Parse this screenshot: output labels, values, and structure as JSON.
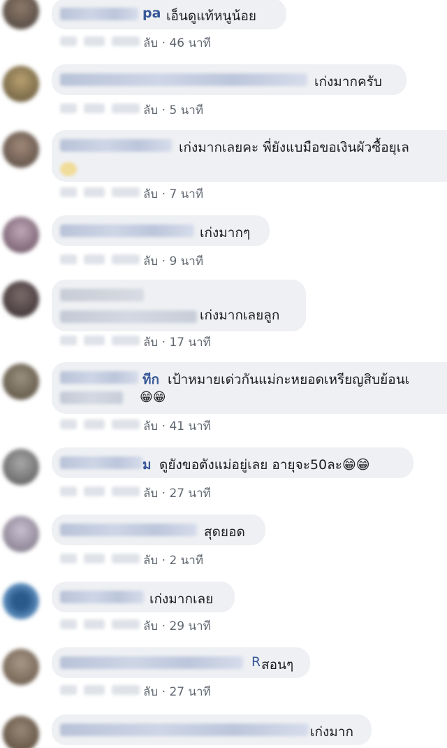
{
  "comments": [
    {
      "name_visible": "pa",
      "text": "เอ็นดูแท้หนูน้อย",
      "reply_fragment": "ลับ",
      "time": "46 นาที"
    },
    {
      "name_visible": "",
      "text": "เก่งมากครับ",
      "reply_fragment": "ลับ",
      "time": "5 นาที"
    },
    {
      "name_visible": "",
      "text": "เก่งมากเลยคะ พี่ยังแบมือขอเงินผัวซื้อยุเล",
      "reply_fragment": "ลับ",
      "time": "7 นาที"
    },
    {
      "name_visible": "",
      "text": "เก่งมากๆ",
      "reply_fragment": "ลับ",
      "time": "9 นาที"
    },
    {
      "name_visible": "",
      "text": "เก่งมากเลยลูก",
      "reply_fragment": "ลับ",
      "time": "17 นาที"
    },
    {
      "name_visible": "ทีก",
      "text": "เป้าหมายเด่วกันแม่กะหยอดเหรียญสิบย้อนเ",
      "text_line2": "😁😁",
      "reply_fragment": "ลับ",
      "time": "41 นาที"
    },
    {
      "name_visible": "ม",
      "text": "ดูยังขอตังแม่อยู่เลย อายุจะ50ละ😁😁",
      "reply_fragment": "ลับ",
      "time": "27 นาที"
    },
    {
      "name_visible": "",
      "text": "สุดยอด",
      "reply_fragment": "ลับ",
      "time": "2 นาที"
    },
    {
      "name_visible": "",
      "text": "เก่งมากเลย",
      "reply_fragment": "ลับ",
      "time": "29 นาที"
    },
    {
      "name_visible": "R",
      "text": "สอนๆ",
      "reply_fragment": "ลับ",
      "time": "27 นาที"
    },
    {
      "name_visible": "",
      "text": "เก่งมาก",
      "reply_fragment": "",
      "time": ""
    }
  ],
  "separator": "·",
  "colors": {
    "bubble": "#eef0f3",
    "name": "#385898",
    "text": "#1c1e21",
    "meta": "#606770"
  }
}
